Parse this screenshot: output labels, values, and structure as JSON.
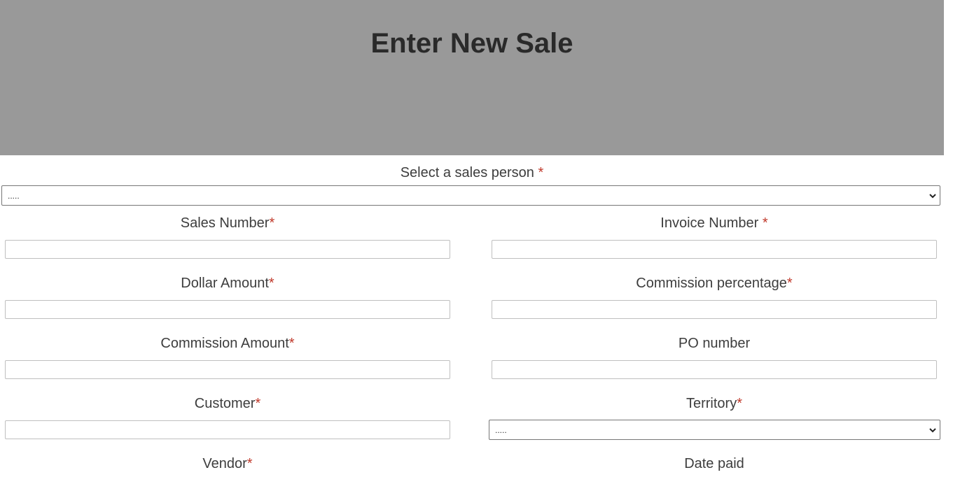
{
  "header": {
    "title": "Enter New Sale"
  },
  "required_marker": "*",
  "sales_person": {
    "label": "Select a sales person ",
    "selected": "....."
  },
  "fields": {
    "sales_number": {
      "label": "Sales Number",
      "value": ""
    },
    "invoice_number": {
      "label": "Invoice Number ",
      "value": ""
    },
    "dollar_amount": {
      "label": "Dollar Amount",
      "value": ""
    },
    "commission_percentage": {
      "label": "Commission percentage",
      "value": ""
    },
    "commission_amount": {
      "label": "Commission Amount",
      "value": ""
    },
    "po_number": {
      "label": "PO number",
      "value": ""
    },
    "customer": {
      "label": "Customer",
      "value": ""
    },
    "territory": {
      "label": "Territory",
      "selected": "....."
    },
    "vendor": {
      "label": "Vendor"
    },
    "date_paid": {
      "label": "Date paid"
    }
  },
  "colors": {
    "header_bg": "#999999",
    "required": "#c0392b"
  }
}
